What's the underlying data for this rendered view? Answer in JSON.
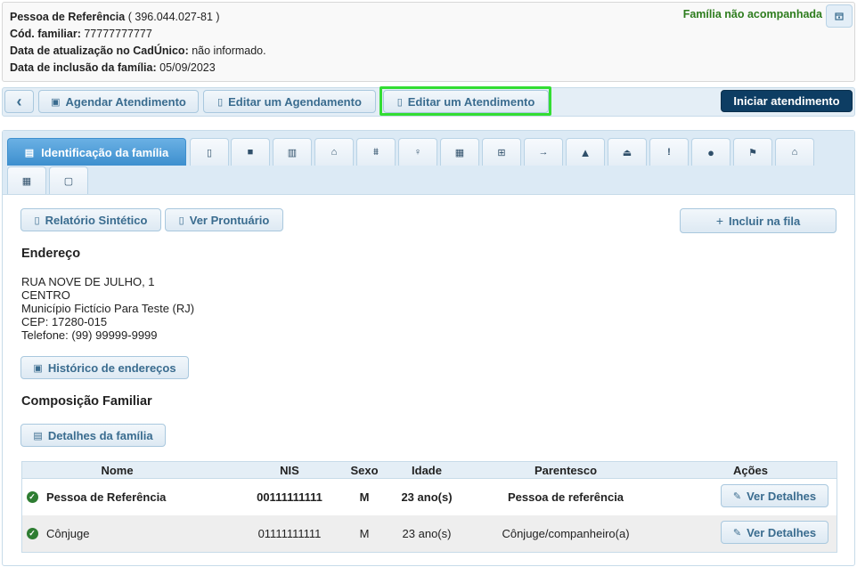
{
  "header": {
    "ref_label": "Pessoa de Referência",
    "ref_value": "( 396.044.027-81 )",
    "cod_label": "Cód. familiar:",
    "cod_value": "77777777777",
    "update_label": "Data de atualização no CadÚnico:",
    "update_value": "não informado.",
    "inclusion_label": "Data de inclusão da família:",
    "inclusion_value": "05/09/2023",
    "status": "Família não acompanhada"
  },
  "toolbar": {
    "back_icon": "‹",
    "schedule_label": "Agendar Atendimento",
    "edit_schedule_label": "Editar um Agendamento",
    "edit_attendance_label": "Editar um Atendimento",
    "start_label": "Iniciar atendimento"
  },
  "tabs": {
    "active_label": "Identificação da família",
    "icons": [
      "clipboard-icon",
      "book-icon",
      "columns-icon",
      "home-icon",
      "bank-icon",
      "lightbulb-icon",
      "grid-icon",
      "cart-icon",
      "arrow-icon",
      "warning-icon",
      "user-icon",
      "exclamation-icon",
      "info-icon",
      "flag-icon",
      "house-icon",
      "table-icon",
      "file-icon"
    ]
  },
  "actions": {
    "synthetic_report": "Relatório Sintético",
    "view_record": "Ver Prontuário",
    "add_queue": "Incluir na fila"
  },
  "address": {
    "title": "Endereço",
    "line1": "RUA NOVE DE JULHO, 1",
    "line2": "CENTRO",
    "line3": "Município Fictício Para Teste (RJ)",
    "line4": "CEP: 17280-015",
    "line5": "Telefone: (99) 99999-9999",
    "history_label": "Histórico de endereços"
  },
  "family": {
    "title": "Composição Familiar",
    "details_label": "Detalhes da família",
    "columns": [
      "Nome",
      "NIS",
      "Sexo",
      "Idade",
      "Parentesco",
      "Ações"
    ],
    "rows": [
      {
        "name": "Pessoa de Referência",
        "nis": "00111111111",
        "sex": "M",
        "age": "23 ano(s)",
        "relation": "Pessoa de referência",
        "action": "Ver Detalhes"
      },
      {
        "name": "Cônjuge",
        "nis": "01111111111",
        "sex": "M",
        "age": "23 ano(s)",
        "relation": "Cônjuge/companheiro(a)",
        "action": "Ver Detalhes"
      }
    ]
  }
}
